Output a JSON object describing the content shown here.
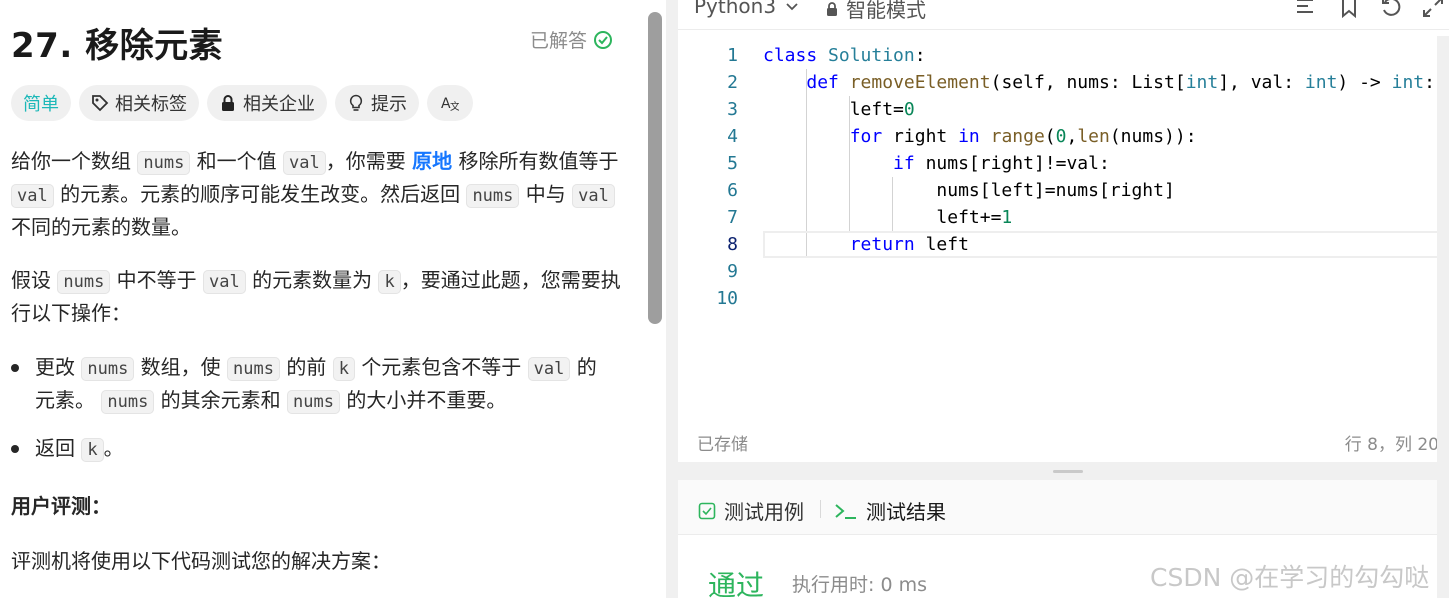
{
  "problem": {
    "title": "27. 移除元素",
    "solved_label": "已解答",
    "tags": [
      {
        "label": "简单",
        "icon": ""
      },
      {
        "label": "相关标签",
        "icon": "tag-icon"
      },
      {
        "label": "相关企业",
        "icon": "lock-icon"
      },
      {
        "label": "提示",
        "icon": "lightbulb-icon"
      },
      {
        "label": "",
        "icon": "translate-icon"
      }
    ],
    "p1": {
      "t1": "给你一个数组",
      "c1": "nums",
      "t2": "和一个值",
      "c2": "val",
      "t3": "，你需要",
      "b1": "原地",
      "t4": "移除所有数值等于",
      "c3": "val",
      "t5": "的元素。元素的顺序可能发生改变。然后返回",
      "c4": "nums",
      "t6": "中与",
      "c5": "val",
      "t7": "不同的元素的数量。"
    },
    "p2": {
      "t1": "假设",
      "c1": "nums",
      "t2": "中不等于",
      "c2": "val",
      "t3": "的元素数量为",
      "c3": "k",
      "t4": "，要通过此题，您需要执行以下操作："
    },
    "b1": {
      "t1": "更改",
      "c1": "nums",
      "t2": "数组，使",
      "c2": "nums",
      "t3": "的前",
      "c3": "k",
      "t4": "个元素包含不等于",
      "c4": "val",
      "t5": "的元素。",
      "c5": "nums",
      "t6": "的其余元素和",
      "c6": "nums",
      "t7": "的大小并不重要。"
    },
    "b2": {
      "t1": "返回",
      "c1": "k",
      "t2": "。"
    },
    "eval_title": "用户评测：",
    "eval_desc": "评测机将使用以下代码测试您的解决方案："
  },
  "editor": {
    "language": "Python3",
    "mode": "智能模式",
    "status": "已存储",
    "cursor": "行 8，列 20",
    "line_numbers": [
      "1",
      "2",
      "3",
      "4",
      "5",
      "6",
      "7",
      "8",
      "9",
      "10"
    ],
    "tokens": {
      "l1": [
        "class",
        "Solution",
        ":"
      ],
      "l2": [
        "def",
        "removeElement",
        "(self, nums: List[",
        "int",
        "], val: ",
        "int",
        ") -> ",
        "int",
        ":"
      ],
      "l3": [
        "left=",
        "0"
      ],
      "l4": [
        "for",
        " right ",
        "in",
        " ",
        "range",
        "(",
        "0",
        ",",
        "len",
        "(nums)):"
      ],
      "l5": [
        "if",
        " nums[right]!=val:"
      ],
      "l6": [
        "nums[left]=nums[right]"
      ],
      "l7": [
        "left+=",
        "1"
      ],
      "l8": [
        "return",
        " left"
      ]
    }
  },
  "results": {
    "tab_cases": "测试用例",
    "tab_results": "测试结果",
    "status": "通过",
    "runtime": "执行用时: 0 ms"
  },
  "watermark": "CSDN @在学习的勾勾哒",
  "colors": {
    "accent": "#1677ff",
    "easy": "#1cb8b8",
    "pass": "#2db55d"
  }
}
